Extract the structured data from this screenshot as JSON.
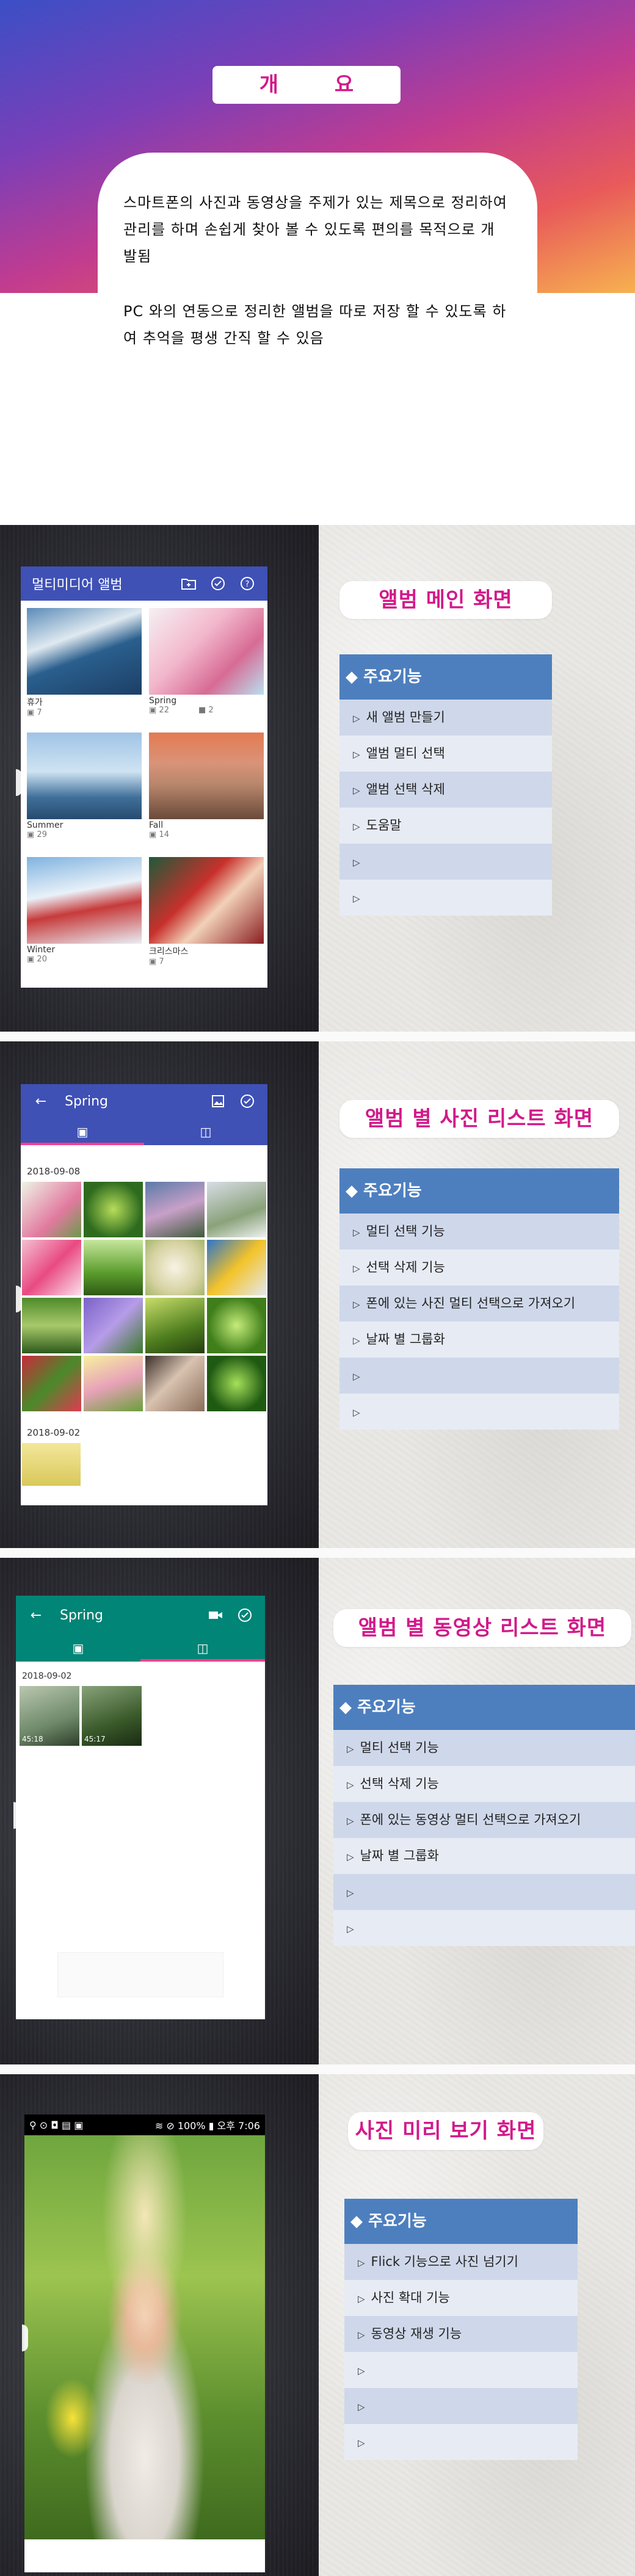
{
  "intro": {
    "title": "개 요",
    "paragraph1": "스마트폰의 사진과 동영상을 주제가 있는 제목으로 정리하여 관리를 하며 손쉽게 찾아 볼 수 있도록 편의를 목적으로 개발됨",
    "paragraph2": "PC 와의 연동으로 정리한 앨범을 따로 저장 할 수 있도록 하여 추억을 평생 간직 할 수 있음"
  },
  "feature_header": "◆ 주요기능",
  "sections": {
    "album_main": {
      "title": "앨범 메인 화면",
      "features": [
        "새 앨범 만들기",
        "앨범 멀티 선택",
        "앨범 선택 삭제",
        "도움말",
        "",
        ""
      ],
      "app": {
        "title": "멀티미디어 앨범",
        "albums": [
          {
            "name": "휴가",
            "photos": "7",
            "videos": ""
          },
          {
            "name": "Spring",
            "photos": "22",
            "videos": "2"
          },
          {
            "name": "Summer",
            "photos": "29",
            "videos": ""
          },
          {
            "name": "Fall",
            "photos": "14",
            "videos": ""
          },
          {
            "name": "Winter",
            "photos": "20",
            "videos": ""
          },
          {
            "name": "크리스마스",
            "photos": "7",
            "videos": ""
          }
        ]
      }
    },
    "photo_list": {
      "title": "앨범 별 사진 리스트 화면",
      "features": [
        "멀티 선택 기능",
        "선택 삭제 기능",
        "폰에 있는 사진 멀티 선택으로 가져오기",
        "날짜 별 그룹화",
        "",
        ""
      ],
      "app": {
        "title": "Spring",
        "date1": "2018-09-08",
        "date2": "2018-09-02"
      }
    },
    "video_list": {
      "title": "앨범 별 동영상 리스트 화면",
      "features": [
        "멀티 선택 기능",
        "선택 삭제 기능",
        "폰에 있는 동영상 멀티 선택으로 가져오기",
        "날짜 별 그룹화",
        "",
        ""
      ],
      "app": {
        "title": "Spring",
        "date": "2018-09-02",
        "durations": [
          "45:18",
          "45:17"
        ]
      }
    },
    "preview": {
      "title": "사진 미리 보기 화면",
      "features": [
        "Flick 기능으로 사진 넘기기",
        "사진 확대 기능",
        "동영상 재생 기능",
        "",
        "",
        ""
      ],
      "status": {
        "left": "⚲ ⊙ ◘ ▤ ▣",
        "right": "≋ ⊘ 100% ▮ 오후 7:06"
      }
    }
  },
  "colors": {
    "accent": "#d21a8a",
    "feature_head": "#4d7fbf",
    "album_bar": "#3f51b5",
    "video_bar": "#008577",
    "tab_indicator": "#ff3d8a"
  },
  "icons": [
    "folder-add-icon",
    "check-circle-icon",
    "help-icon",
    "back-arrow-icon",
    "image-icon",
    "video-icon",
    "photo-tab-icon",
    "video-tab-icon",
    "camera-icon"
  ]
}
